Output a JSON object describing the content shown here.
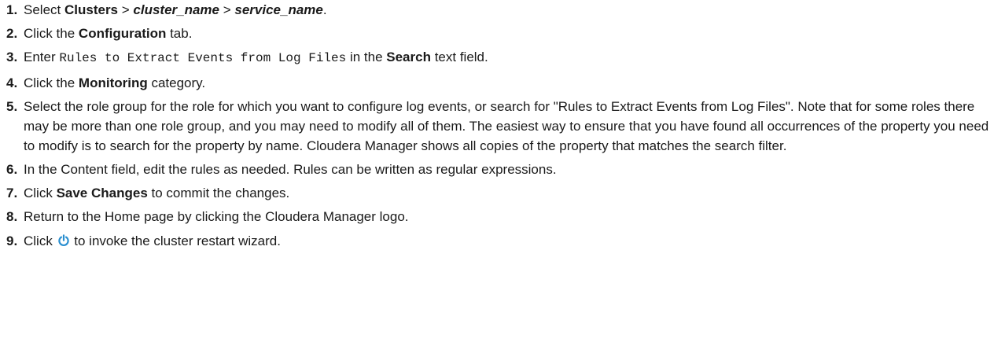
{
  "steps": [
    {
      "num": "1.",
      "t1": "Select ",
      "b1": "Clusters",
      "t2": " > ",
      "i1": "cluster_name",
      "t3": " > ",
      "i2": "service_name",
      "t4": "."
    },
    {
      "num": "2.",
      "t1": "Click the ",
      "b1": "Configuration",
      "t2": " tab."
    },
    {
      "num": "3.",
      "t1": "Enter ",
      "code": "Rules to Extract Events from Log Files",
      "t2": " in the ",
      "b1": "Search",
      "t3": " text field."
    },
    {
      "num": "4.",
      "t1": "Click the ",
      "b1": "Monitoring",
      "t2": " category."
    },
    {
      "num": "5.",
      "text": "Select the role group for the role for which you want to configure log events, or search for \"Rules to Extract Events from Log Files\". Note that for some roles there may be more than one role group, and you may need to modify all of them. The easiest way to ensure that you have found all occurrences of the property you need to modify is to search for the property by name. Cloudera Manager shows all copies of the property that matches the search filter."
    },
    {
      "num": "6.",
      "text": "In the Content field, edit the rules as needed. Rules can be written as regular expressions."
    },
    {
      "num": "7.",
      "t1": "Click ",
      "b1": "Save Changes",
      "t2": " to commit the changes."
    },
    {
      "num": "8.",
      "text": "Return to the Home page by clicking the Cloudera Manager logo."
    },
    {
      "num": "9.",
      "t1": "Click ",
      "icon": "power-restart-icon",
      "t2": " to invoke the cluster restart wizard."
    }
  ],
  "colors": {
    "text": "#1a1a1a",
    "icon": "#2a8fd0"
  }
}
